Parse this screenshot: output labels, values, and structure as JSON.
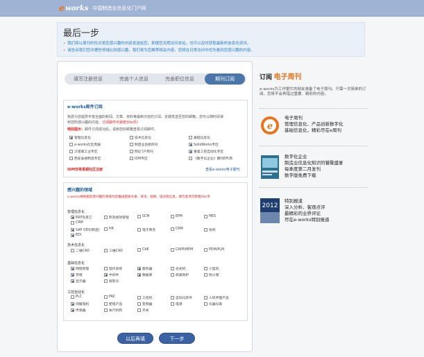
{
  "site": {
    "logo_e": "e",
    "logo_works": "works",
    "tagline": "中国制造业信息化门户网"
  },
  "header": {
    "title": "最后一步",
    "note1": "我们将以周刊的形式将您感兴趣的内容发送给您，即便您无暇访问本站，也可以及时获取最新的信息化资讯。",
    "note2": "请告诉我们您对哪些领域比较感兴趣，我们将为您推荐相关内容，您将在日常访问中优先看到您感兴趣的内容。"
  },
  "steps": [
    "填写注册信息",
    "完善个人信息",
    "完善职位信息",
    "期刊订阅"
  ],
  "sub": {
    "title": "e-works邮件订阅",
    "line1": "免费为您提供丰富全面的新闻、文章、资料等最新内容的订阅，定期发送至您的邮箱，您可以随时阅读",
    "line2": "到您所感兴趣的内容。",
    "line2b": "订阅邮件可获赠30e币》",
    "special_label": "特别提示：",
    "special_text": "邮件订阅成功后，请到您的邮箱查看订阅邮件。",
    "items": [
      "管理信息化",
      "技术信息化",
      "基础信息化",
      "e-works社区周报",
      "制造业创新风刊",
      "SolidWorks专区",
      "汉诺威工业专区",
      "BSJ门户周刊",
      "基督工控自动化专区",
      "西安泰德制造专区",
      "IDM专区",
      "《数字化企业》期刊EPUB"
    ],
    "magazine_link": "IDM非常青期社区注册",
    "view_link": "查看e-works电子期刊"
  },
  "interest": {
    "title": "感兴趣的领域",
    "hint": "e-works将根据您感兴趣的领域为您推送相关文章、资讯、视频、培训等信息，填写此项可获赠30e币",
    "group1": {
      "name": "管理信息化",
      "items": [
        "ERP及其它",
        "BI及绩效管理",
        "SCM",
        "EPM",
        "MES",
        "CRM",
        "",
        "",
        "",
        "",
        "SAP ODS(制造)",
        "HR",
        "电子商务",
        "CRM",
        "协同",
        "EDI"
      ]
    },
    "group2": {
      "name": "技术信息化",
      "items": [
        "二维CAD",
        "三维CAD",
        "CAE",
        "CAPP/MPM",
        "PDM/PLM"
      ]
    },
    "group3": {
      "name": "基础信息化",
      "items": [
        "网络管理",
        "操作系统",
        "服务器",
        "台式机",
        "小型机",
        "存储",
        "中间件",
        "数据库",
        "病毒防护",
        "防火墙",
        "显示器",
        "投影仪"
      ]
    },
    "group4": {
      "name": "工控自动化",
      "items": [
        "PLC",
        "PAC",
        "工控机",
        "自动化软件",
        "人机界面产品",
        "伺服电机",
        "配电产品",
        "变频器",
        "电源",
        "仪器仪表",
        "传感器",
        "执行机构",
        "开关"
      ]
    }
  },
  "buttons": {
    "later": "以后再填",
    "next": "下一步"
  },
  "side": {
    "title_prefix": "订阅",
    "title_hl": "电子周刊",
    "desc": "e-works为工作繁忙的网友准备了电子周刊。只需一次简单的订阅，您将不会再错过重要、精彩的内容。",
    "item1": [
      "电子周刊",
      "管理信息化、产品创新数字化",
      "基础信息化，精彩尽在e周刊"
    ],
    "item2": [
      "数字化企业",
      "制造业信息化知识的饕餮盛宴",
      "每季度第二月发刊",
      "数字版免费下载"
    ],
    "item3_year": "2012",
    "item3": [
      "特别报道",
      "深入分析、客观点评",
      "最精彩的业界评论",
      "尽在e-works特别报道"
    ]
  },
  "colors": {
    "accent": "#e8741c",
    "primary": "#3b63a3",
    "link": "#2a7fc9"
  }
}
